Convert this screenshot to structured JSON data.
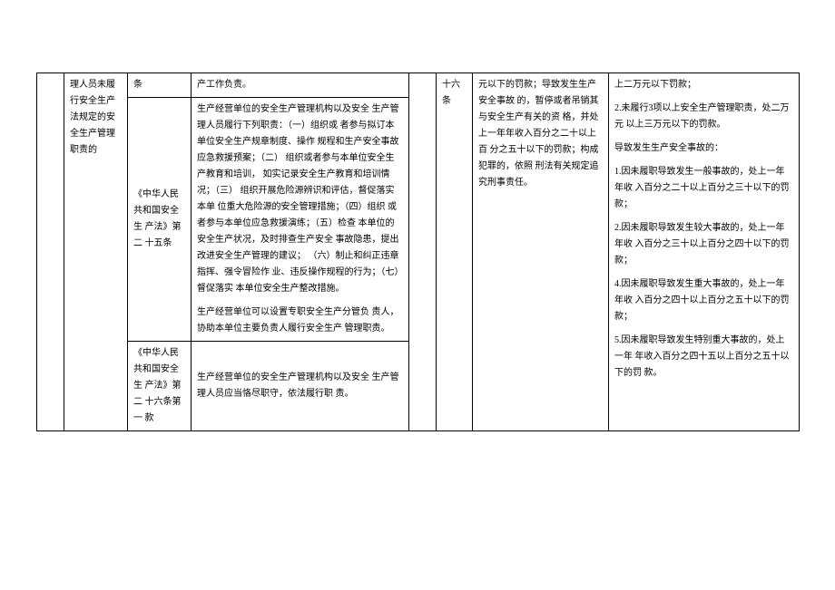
{
  "table": {
    "col2_text": "理人员未履行安全生产法规定的安全生产管理职责的",
    "row1": {
      "col3": "条",
      "col4": "产工作负责。",
      "col6": "十六条"
    },
    "row2": {
      "col3": "《中华人民共和国安全生 产法》第二 十五条",
      "col4_p1": "生产经营单位的安全生产管理机构以及安全 生产管理人员履行下列职责：（一）组织或 者参与拟订本单位安全生产规章制度、操作 规程和生产安全事故应急救援预案；（二） 组织或者参与本单位安全生产教育和培训， 如实记录安全生产教育和培训情况；（三） 组织开展危险源辨识和评估，督促落实本单 位重大危险源的安全管理措施；（四）组织 或者参与本单位应急救援演练；（五）检查 本单位的安全生产状况，及时排查生产安全 事故隐患，提出改进安全生产管理的建议； （六）制止和纠正违章指挥、强令冒险作 业、违反操作规程的行为；（七）督促落实 本单位安全生产整改措施。",
      "col4_p2": "生产经营单位可以设置专职安全生产分管负 责人，协助本单位主要负责人履行安全生产 管理职责。"
    },
    "row3": {
      "col3": "《中华人民共和国安全生 产法》第二 十六条第一 款",
      "col4": "生产经营单位的安全生产管理机构以及安全 生产管理人员应当恪尽职守，依法履行职 责。"
    },
    "col7_text": "元以下的罚款；导致发生生产安全事故 的，暂停或者吊销其与安全生产有关的资 格，并处上一年年收入百分之二十以上百 分之五十以下的罚款；构成犯罪的，依照 刑法有关规定追究刑事责任。",
    "col8": {
      "p1": "上二万元以下罚款；",
      "p2": "2.未履行3项以上安全生产管理职责，处二万元 以上三万元以下的罚款。",
      "p3": "导致发生生产安全事故的：",
      "p4": "1.因未履职导致发生一般事故的，处上一年年收 入百分之二十以上百分之三十以下的罚款；",
      "p5": "2.因未履职导致发生较大事故的，处上一年年收 入百分之三十以上百分之四十以下的罚款；",
      "p6": "4.因未履职导致发生重大事故的，处上一年年收 入百分之四十以上百分之五十以下的罚款；",
      "p7": "5.因未履职导致发生特别重大事故的，处上一年 年收入百分之四十五以上百分之五十以下的罚 款。"
    }
  }
}
